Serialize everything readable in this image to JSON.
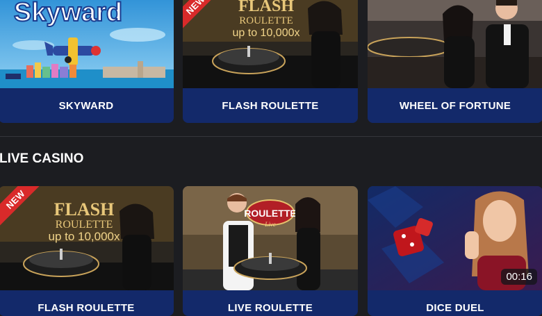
{
  "top_games": [
    {
      "title": "SKYWARD",
      "art_text": "Skyward",
      "badge": ""
    },
    {
      "title": "FLASH ROULETTE",
      "art_line1": "FLASH",
      "art_line2": "ROULETTE",
      "art_line3": "up to 10,000x",
      "badge": "NEW"
    },
    {
      "title": "WHEEL OF FORTUNE",
      "badge": ""
    }
  ],
  "live_section": {
    "title": "LIVE CASINO",
    "games": [
      {
        "title": "FLASH ROULETTE",
        "art_line1": "FLASH",
        "art_line2": "ROULETTE",
        "art_line3": "up to 10,000x",
        "badge": "NEW"
      },
      {
        "title": "LIVE ROULETTE",
        "art_logo": "ROULETTE",
        "art_sub": "Live"
      },
      {
        "title": "DICE DUEL",
        "timer": "00:16"
      }
    ]
  },
  "colors": {
    "background": "#1c1d21",
    "label_bar": "#13296a",
    "new_badge": "#d92a2a",
    "gold": "#e8c77a"
  }
}
